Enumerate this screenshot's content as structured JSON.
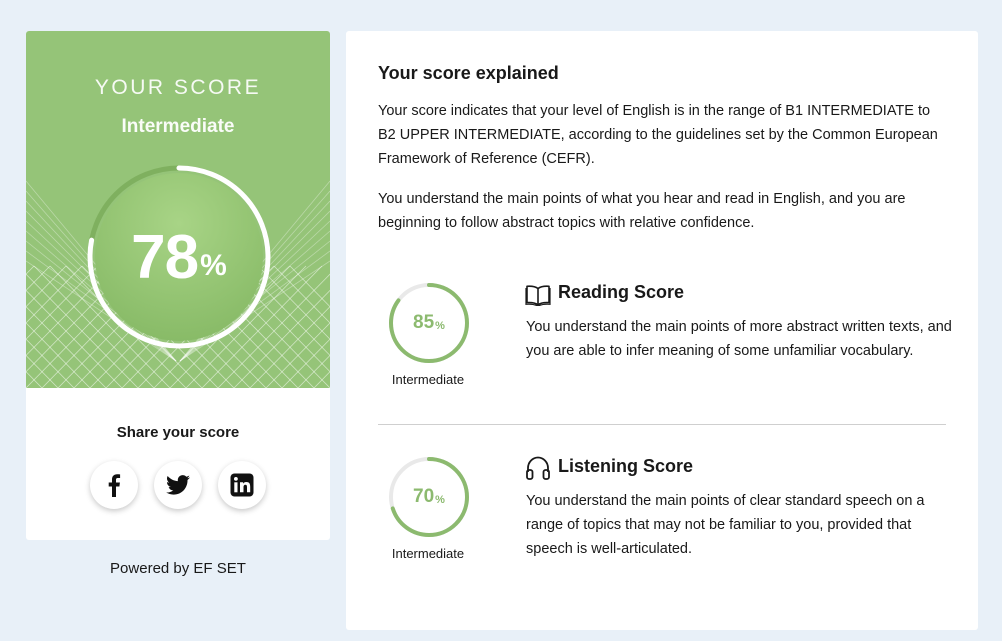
{
  "score_card": {
    "title": "YOUR SCORE",
    "level": "Intermediate",
    "score": 78,
    "score_display": "78",
    "percent_sign": "%",
    "accent_color": "#95c478",
    "share_title": "Share your score",
    "share_buttons": [
      {
        "name": "facebook",
        "icon": "facebook-icon"
      },
      {
        "name": "twitter",
        "icon": "twitter-icon"
      },
      {
        "name": "linkedin",
        "icon": "linkedin-icon"
      }
    ]
  },
  "footer": {
    "powered_by": "Powered by EF SET"
  },
  "explanation": {
    "title": "Your score explained",
    "paragraph_1": "Your score indicates that your level of English is in the range of B1 INTERMEDIATE to B2 UPPER INTERMEDIATE, according to the guidelines set by the Common European Framework of Reference (CEFR).",
    "paragraph_2": "You understand the main points of what you hear and read in English, and you are beginning to follow abstract topics with relative confidence."
  },
  "reading": {
    "score": 85,
    "score_display": "85",
    "percent_sign": "%",
    "level": "Intermediate",
    "icon": "book-icon",
    "title": "Reading Score",
    "text": "You understand the main points of more abstract written texts, and you are able to infer meaning of some unfamiliar vocabulary."
  },
  "listening": {
    "score": 70,
    "score_display": "70",
    "percent_sign": "%",
    "level": "Intermediate",
    "icon": "headphones-icon",
    "title": "Listening Score",
    "text": "You understand the main points of clear standard speech on a range of topics that may not be familiar to you, provided that speech is well-articulated."
  },
  "colors": {
    "page_background": "#e8f0f8",
    "gauge_green": "#8cba6f",
    "hero_green": "#95c478"
  }
}
